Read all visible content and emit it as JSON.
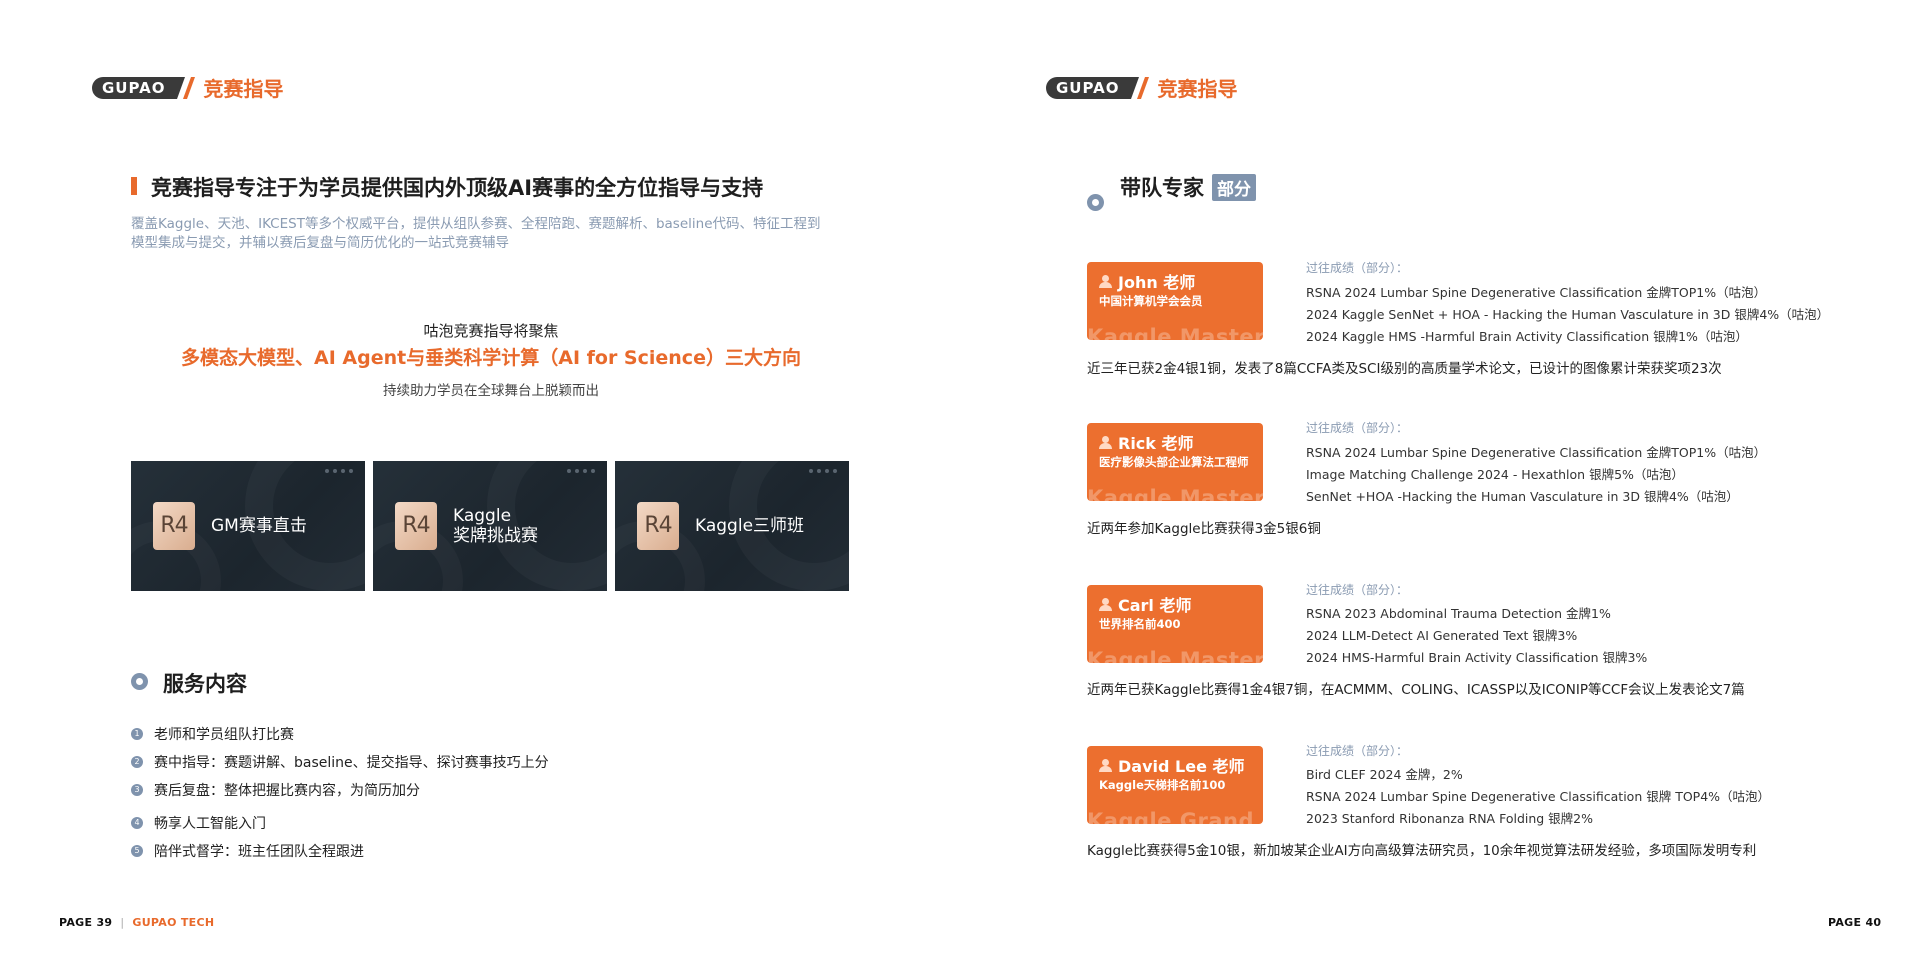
{
  "header": {
    "logo_text": "GUPAO",
    "section": "竞赛指导"
  },
  "left": {
    "headline": "竞赛指导专注于为学员提供国内外顶级AI赛事的全方位指导与支持",
    "intro_line1": "覆盖Kaggle、天池、IKCEST等多个权威平台，提供从组队参赛、全程陪跑、赛题解析、baseline代码、特征工程到",
    "intro_line2": "模型集成与提交，并辅以赛后复盘与简历优化的一站式竞赛辅导",
    "focus": {
      "line1": "咕泡竞赛指导将聚焦",
      "line2": "多模态大模型、AI Agent与垂类科学计算（AI for Science）三大方向",
      "line3": "持续助力学员在全球舞台上脱颖而出"
    },
    "cards": [
      {
        "badge": "R4",
        "label_line1": "GM赛事直击",
        "label_line2": ""
      },
      {
        "badge": "R4",
        "label_line1": "Kaggle",
        "label_line2": "奖牌挑战赛"
      },
      {
        "badge": "R4",
        "label_line1": "Kaggle三师班",
        "label_line2": ""
      }
    ],
    "services_title": "服务内容",
    "services": [
      {
        "num": "1",
        "text": "老师和学员组队打比赛"
      },
      {
        "num": "2",
        "text": "赛中指导：赛题讲解、baseline、提交指导、探讨赛事技巧上分"
      },
      {
        "num": "3",
        "text": "赛后复盘：整体把握比赛内容，为简历加分"
      },
      {
        "num": "4",
        "text": "畅享人工智能入门"
      },
      {
        "num": "5",
        "text": "陪伴式督学：班主任团队全程跟进"
      }
    ],
    "footer": {
      "page": "PAGE  39",
      "sep": "|",
      "brand": "GUPAO TECH"
    }
  },
  "right": {
    "title": "带队专家",
    "tag": "部分",
    "experts": [
      {
        "name": "John 老师",
        "role": "中国计算机学会会员",
        "watermark": "Kaggle Master",
        "past_label": "过往成绩（部分）：",
        "items": [
          "RSNA 2024 Lumbar Spine Degenerative Classification 金牌TOP1%（咕泡）",
          "2024 Kaggle SenNet + HOA - Hacking the Human Vasculature in 3D 银牌4%（咕泡）",
          "2024 Kaggle HMS -Harmful Brain Activity Classification 银牌1%（咕泡）"
        ],
        "summary": "近三年已获2金4银1铜，发表了8篇CCFA类及SCI级别的高质量学术论文，已设计的图像累计荣获奖项23次"
      },
      {
        "name": "Rick 老师",
        "role": "医疗影像头部企业算法工程师",
        "watermark": "Kaggle Master",
        "past_label": "过往成绩（部分）：",
        "items": [
          "RSNA 2024 Lumbar Spine Degenerative Classification 金牌TOP1%（咕泡）",
          "Image Matching Challenge 2024 - Hexathlon 银牌5%（咕泡）",
          "SenNet +HOA -Hacking the Human Vasculature in 3D 银牌4%（咕泡）"
        ],
        "summary": "近两年参加Kaggle比赛获得3金5银6铜"
      },
      {
        "name": "Carl 老师",
        "role": "世界排名前400",
        "watermark": "Kaggle Master",
        "past_label": "过往成绩（部分）：",
        "items": [
          "RSNA 2023 Abdominal Trauma Detection 金牌1%",
          "2024 LLM-Detect AI Generated Text 银牌3%",
          "2024 HMS-Harmful Brain Activity Classification 银牌3%"
        ],
        "summary": "近两年已获Kaggle比赛得1金4银7铜，在ACMMM、COLING、ICASSP以及ICONIP等CCF会议上发表论文7篇"
      },
      {
        "name": "David Lee 老师",
        "role": "Kaggle天梯排名前100",
        "watermark": "Kaggle Grand Master",
        "past_label": "过往成绩（部分）：",
        "items": [
          "Bird CLEF 2024 金牌，2%",
          "RSNA 2024 Lumbar Spine Degenerative Classification 银牌 TOP4%（咕泡）",
          "2023 Stanford Ribonanza RNA Folding 银牌2%"
        ],
        "summary": "Kaggle比赛获得5金10银，新加坡某企业AI方向高级算法研究员，10余年视觉算法研发经验，多项国际发明专利"
      }
    ],
    "footer": {
      "page": "PAGE  40"
    }
  },
  "colors": {
    "accent": "#e86a2c",
    "muted_blue": "#7f93ad",
    "card_dark": "#1f2931"
  }
}
